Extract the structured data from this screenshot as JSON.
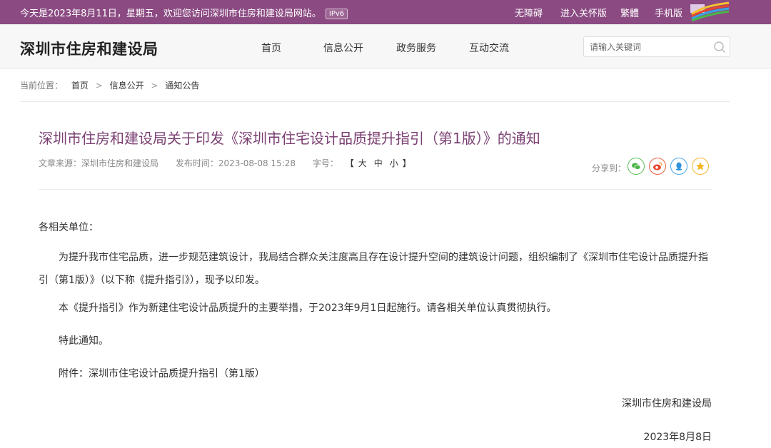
{
  "topbar": {
    "welcome": "今天是2023年8月11日，星期五，欢迎您访问深圳市住房和建设局网站。",
    "ipv6_badge": "IPv6",
    "links": [
      "无障碍",
      "进入关怀版",
      "繁體",
      "手机版"
    ],
    "bg_color": "#8b4a82"
  },
  "header": {
    "site_title": "深圳市住房和建设局",
    "nav": [
      "首页",
      "信息公开",
      "政务服务",
      "互动交流"
    ],
    "search_placeholder": "请输入关键词"
  },
  "breadcrumb": {
    "label": "当前位置：",
    "items": [
      "首页",
      "信息公开",
      "通知公告"
    ],
    "separator": ">"
  },
  "article": {
    "title": "深圳市住房和建设局关于印发《深圳市住宅设计品质提升指引（第1版）》的通知",
    "meta": {
      "source_label": "文章来源：",
      "source": "深圳市住房和建设局",
      "published_label": "发布时间：",
      "published": "2023-08-08 15:28",
      "font_label": "字号：",
      "font_open": "【",
      "font_large": "大",
      "font_medium": "中",
      "font_small": "小",
      "font_close": "】"
    },
    "share_label": "分享到：",
    "share_icons": [
      "wechat-icon",
      "weibo-icon",
      "qq-icon",
      "qzone-icon"
    ],
    "salutation": "各相关单位：",
    "paragraphs": [
      "为提升我市住宅品质，进一步规范建筑设计，我局结合群众关注度高且存在设计提升空间的建筑设计问题，组织编制了《深圳市住宅设计品质提升指引（第1版）》（以下称《提升指引》），现予以印发。",
      "本《提升指引》作为新建住宅设计品质提升的主要举措，于2023年9月1日起施行。请各相关单位认真贯彻执行。",
      "特此通知。",
      "附件：深圳市住宅设计品质提升指引（第1版）"
    ],
    "signature": "深圳市住房和建设局",
    "date": "2023年8月8日",
    "title_color": "#7a3f72"
  }
}
